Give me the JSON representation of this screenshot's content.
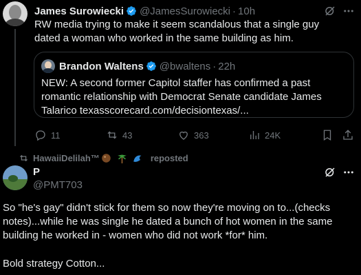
{
  "tweet1": {
    "author_name": "James Surowiecki",
    "author_handle": "@JamesSurowiecki",
    "time": "10h",
    "dot": "·",
    "text": "RW media trying to make it seem scandalous that a single guy dated a woman who worked in the same building as him.",
    "quote": {
      "author_name": "Brandon Waltens",
      "author_handle": "@bwaltens",
      "time": "22h",
      "dot": "·",
      "text": "NEW: A second former Capitol staffer has confirmed a past romantic relationship with Democrat Senate candidate James Talarico texasscorecard.com/decisiontexas/..."
    },
    "actions": {
      "replies": "11",
      "reposts": "43",
      "likes": "363",
      "views": "24K"
    }
  },
  "repost_banner": {
    "reposter": "HawaiiDelilah™",
    "label": "reposted"
  },
  "tweet2": {
    "author_name": "P",
    "author_handle": "@PMT703",
    "text": "So \"he's gay\" didn't stick for them so now they're moving on to...(checks notes)...while he was single he dated a bunch of hot women in the same building he worked in - women who did not work *for* him.",
    "text2": "Bold strategy Cotton..."
  },
  "icons": [
    "grok-icon",
    "more-icon",
    "verified-icon",
    "reply-icon",
    "repost-icon",
    "like-icon",
    "views-icon",
    "coconut-icon",
    "palm-tree-icon",
    "wave-icon"
  ],
  "colors": {
    "background": "#000000",
    "text_primary": "#e7e9ea",
    "text_secondary": "#71767b",
    "verified_blue": "#1d9bf0",
    "border": "#2f3336"
  }
}
